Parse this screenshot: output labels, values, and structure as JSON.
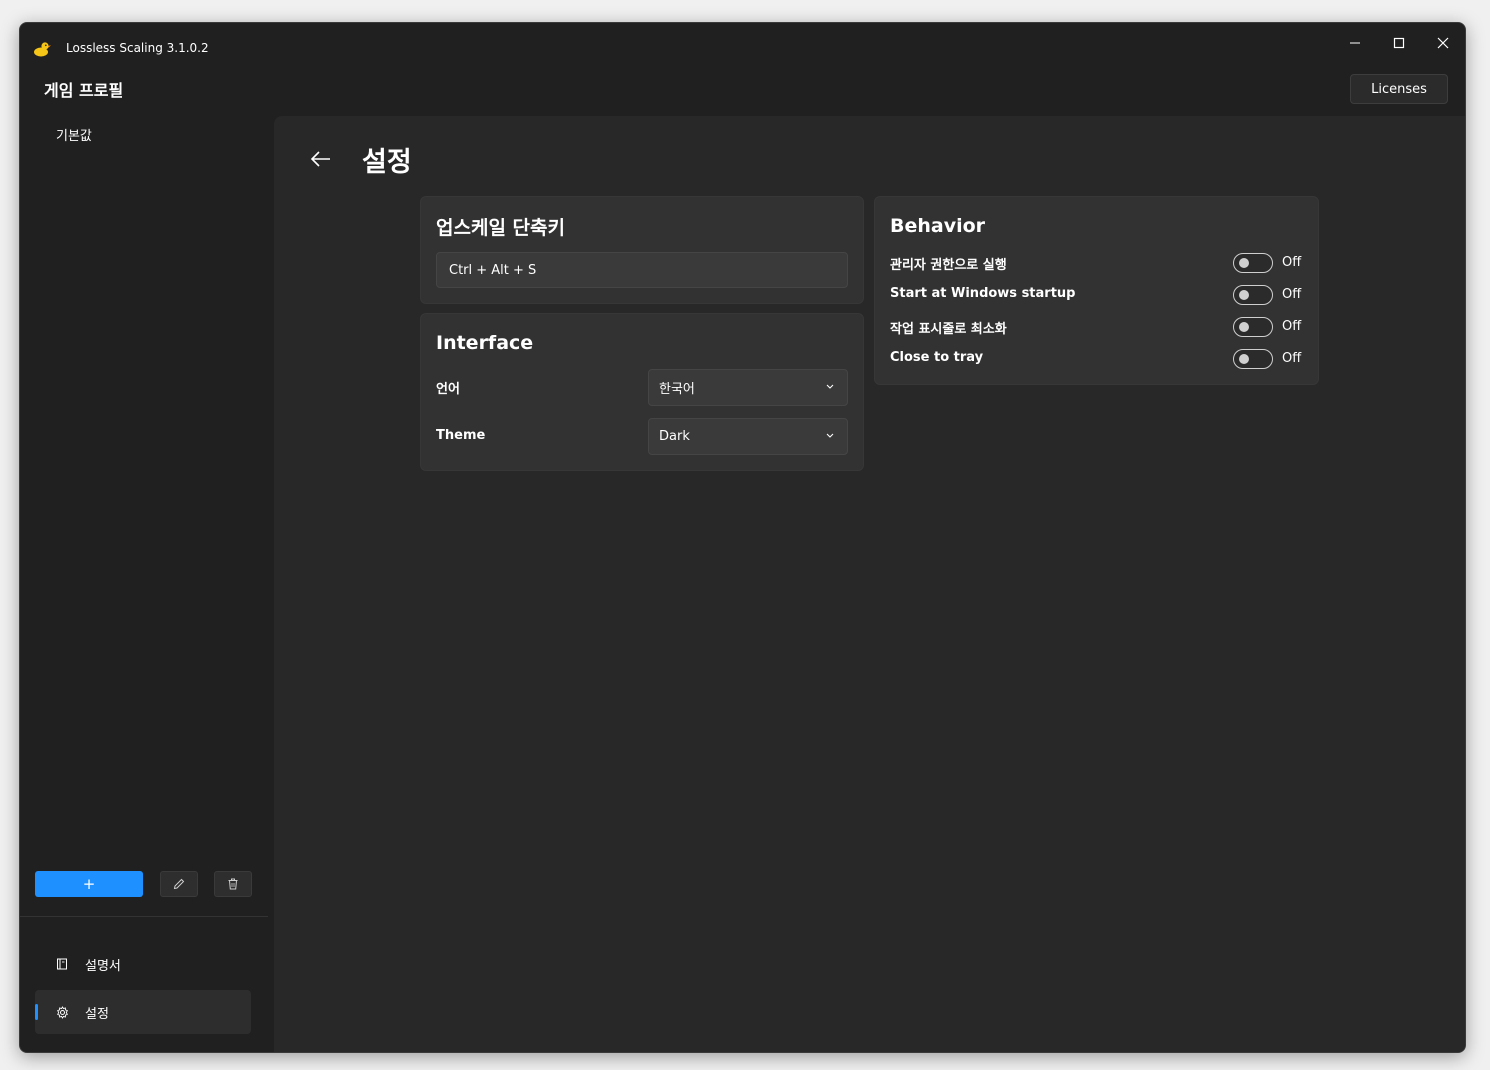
{
  "app": {
    "title": "Lossless Scaling 3.1.0.2",
    "icon": "duck-icon",
    "accent": "#1e90ff"
  },
  "header": {
    "profiles_title": "게임 프로필",
    "licenses_label": "Licenses"
  },
  "sidebar": {
    "profiles": [
      "기본값"
    ],
    "add_label": "+",
    "nav": [
      {
        "label": "설명서",
        "icon": "book-icon"
      },
      {
        "label": "설정",
        "icon": "gear-icon",
        "selected": true
      }
    ]
  },
  "settings": {
    "title": "설정",
    "hotkey": {
      "title": "업스케일 단축키",
      "value": "Ctrl + Alt + S"
    },
    "interface": {
      "title": "Interface",
      "language_label": "언어",
      "language_value": "한국어",
      "theme_label": "Theme",
      "theme_value": "Dark"
    },
    "behavior": {
      "title": "Behavior",
      "items": [
        {
          "label": "관리자 권한으로 실행",
          "state": "Off"
        },
        {
          "label": "Start at Windows startup",
          "state": "Off"
        },
        {
          "label": "작업 표시줄로 최소화",
          "state": "Off"
        },
        {
          "label": "Close to tray",
          "state": "Off"
        }
      ]
    }
  }
}
